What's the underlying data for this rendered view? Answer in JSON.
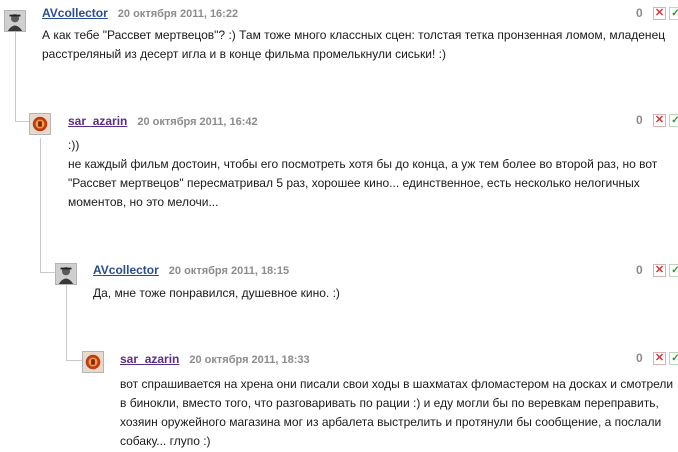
{
  "comments": [
    {
      "author": "AVcollector",
      "date": "20 октября 2011, 16:22",
      "score": "0",
      "avatar": "avatar-person-photo",
      "lines": [
        "А как тебе \"Рассвет мертвецов\"? :) Там тоже много классных сцен: толстая тетка пронзенная ломом, младенец",
        "расстреляный из десерт игла и в конце фильма промелькнули сиськи! :)"
      ]
    },
    {
      "author": "sar_azarin",
      "date": "20 октября 2011, 16:42",
      "score": "0",
      "avatar": "avatar-red-emblem",
      "lines": [
        ":))",
        "не каждый фильм достоин, чтобы его посмотреть хотя бы до конца, а уж тем более во второй раз, но вот",
        "\"Рассвет мертвецов\" пересматривал 5 раз, хорошее кино... единственное, есть несколько нелогичных",
        "моментов, но это мелочи..."
      ]
    },
    {
      "author": "AVcollector",
      "date": "20 октября 2011, 18:15",
      "score": "0",
      "avatar": "avatar-person-photo",
      "lines": [
        "Да, мне тоже понравился, душевное кино. :)"
      ]
    },
    {
      "author": "sar_azarin",
      "date": "20 октября 2011, 18:33",
      "score": "0",
      "avatar": "avatar-red-emblem",
      "lines": [
        "вот спрашивается на хрена они писали свои ходы в шахматах фломастером на досках и смотрели",
        "в бинокли, вместо того, что разговаривать по рации :) и еду могли бы по веревкам переправить,",
        "хозяин оружейного магазина мог из арбалета выстрелить и протянули бы сообщение, а послали",
        "собаку... глупо :)"
      ]
    }
  ],
  "icons": {
    "delete": "✕",
    "approve": "✓"
  },
  "colors": {
    "author_blue": "#2a4d8f",
    "author_purple": "#5c2d82",
    "delete_red": "#d23a3a",
    "approve_green": "#2e9a2e"
  }
}
